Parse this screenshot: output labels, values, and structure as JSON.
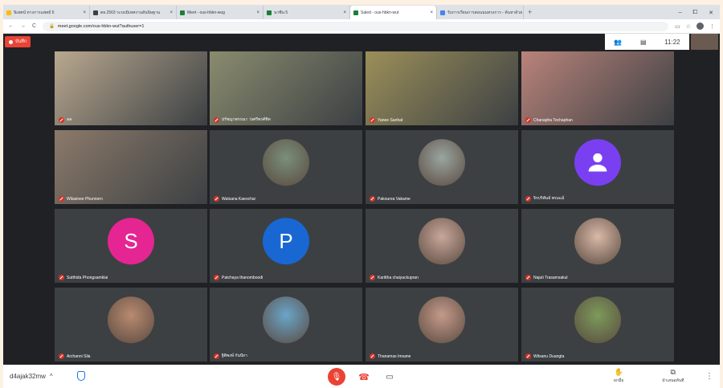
{
  "browser": {
    "tabs": [
      {
        "label": "นิเทศน์ ทางการแพทย์ 5",
        "color": "#fbbc04"
      },
      {
        "label": "ตย.2563 ระบบนิเทศงานสันนิษฐาน",
        "color": "#3c4043"
      },
      {
        "label": "Meet - ous-hbkn-wug",
        "color": "#188038"
      },
      {
        "label": "นาซีน 5",
        "color": "#188038"
      },
      {
        "label": "Saled - ous-hbkn-wut",
        "color": "#188038"
      },
      {
        "label": "รับการเรียนการสอนนนทรงการ - ค้นหาด้วย",
        "color": "#4285f4"
      }
    ],
    "new_tab": "+",
    "window_controls": [
      "–",
      "⧠",
      "✕"
    ],
    "url": "meet.google.com/ous-hbkn-wut?authuser=1",
    "nav": [
      "←",
      "→",
      "C"
    ]
  },
  "meeting": {
    "rec_label": "บันทึก",
    "time": "11:22",
    "participants": [
      {
        "name": "ลล",
        "kind": "photo",
        "bg": "#b9a88f"
      },
      {
        "name": "ปรัชญาพรรณา ว่งศรีพรศ์ชิต",
        "kind": "photo",
        "bg": "#8a8c6e",
        "active": true
      },
      {
        "name": "Yanee Sanhat",
        "kind": "photo",
        "bg": "#9b8f5a"
      },
      {
        "name": "Chanapha Tochaphan",
        "kind": "photo",
        "bg": "#b9837a"
      },
      {
        "name": "Wilasinee Phunnorn",
        "kind": "photo",
        "bg": "#8b7a6a"
      },
      {
        "name": "Watsana Kaeochai",
        "kind": "avatar-photo",
        "bg": "#7a8f7a"
      },
      {
        "name": "Pakourea Vakame",
        "kind": "avatar-photo",
        "bg": "#9aa5a0"
      },
      {
        "name": "จิรบริพันธ์ พรมแม้",
        "kind": "avatar-icon",
        "bg": "#7b3ff2"
      },
      {
        "name": "Sutthida Phongsamklai",
        "kind": "avatar-letter",
        "letter": "S",
        "bg": "#e52592"
      },
      {
        "name": "Patchaya thanomboodi",
        "kind": "avatar-letter",
        "letter": "P",
        "bg": "#1967d2"
      },
      {
        "name": "Karittha chaiyackupran",
        "kind": "avatar-photo",
        "bg": "#c9a79a"
      },
      {
        "name": "Najuti Trasamsakul",
        "kind": "avatar-photo",
        "bg": "#d9b9a8"
      },
      {
        "name": "Archanni Sila",
        "kind": "avatar-photo",
        "bg": "#b98a70"
      },
      {
        "name": "ฐิติพงษ์ กันปัยา",
        "kind": "avatar-photo",
        "bg": "#6aa5c8"
      },
      {
        "name": "Thanamas Imsane",
        "kind": "avatar-photo",
        "bg": "#c49a8a"
      },
      {
        "name": "Witsanu Duangta",
        "kind": "avatar-photo",
        "bg": "#7c9a5a"
      }
    ]
  },
  "bottom": {
    "meeting_code": "d4ajak32mw",
    "caret": "^",
    "raise_hand_label": "ยกมือ",
    "present_label": "นำเสนอทันที",
    "more": "⋮"
  }
}
